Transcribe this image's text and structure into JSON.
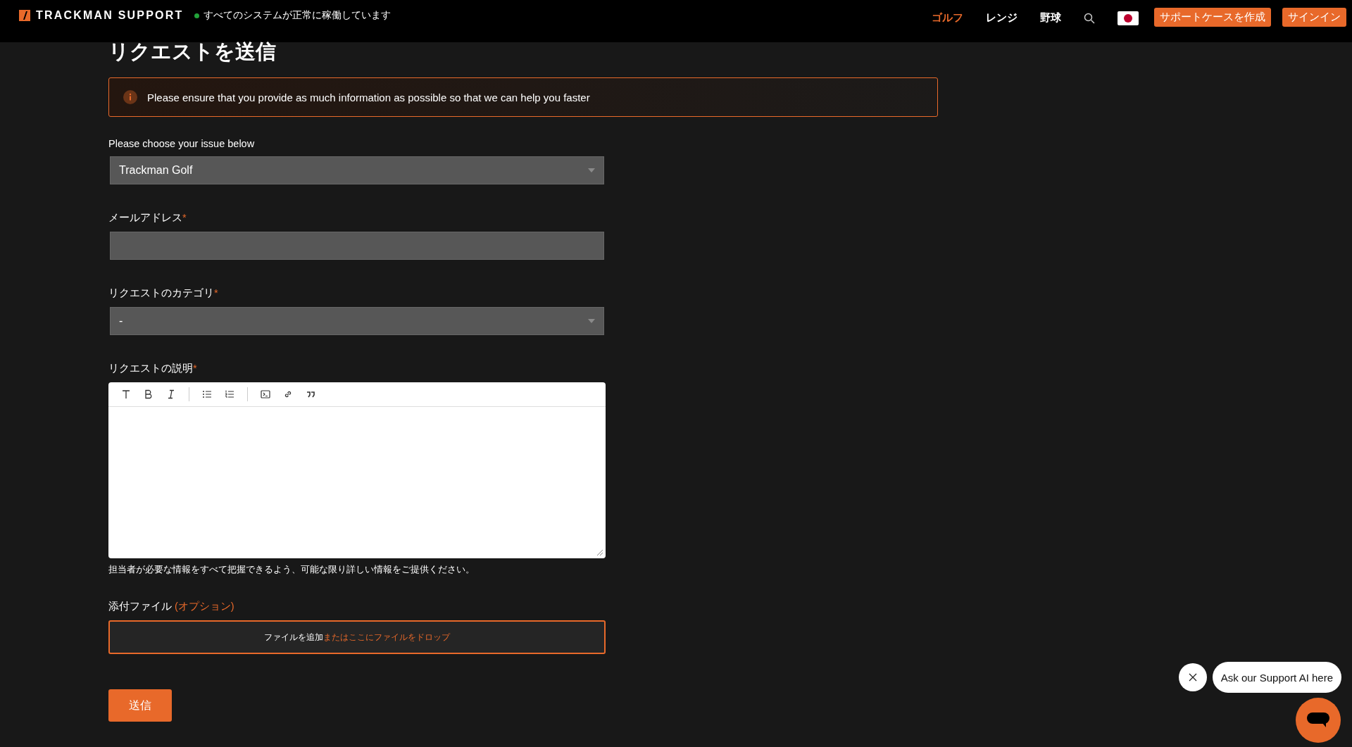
{
  "header": {
    "logo": "TRACKMAN SUPPORT",
    "status": {
      "text": "すべてのシステムが正常に稼働しています",
      "color": "#22a33a"
    },
    "nav": [
      {
        "label": "ゴルフ",
        "selected": true
      },
      {
        "label": "レンジ",
        "selected": false
      },
      {
        "label": "野球",
        "selected": false
      }
    ],
    "buttons": [
      "サポートケースを作成",
      "サインイン"
    ]
  },
  "title": "リクエストを送信",
  "notice": "Please ensure that you provide as much information as possible so that we can help you faster",
  "fields": [
    {
      "kind": "select",
      "label": "Please choose your issue below",
      "value": "Trackman Golf"
    },
    {
      "kind": "text",
      "label": "メールアドレス",
      "required_mark": "*"
    },
    {
      "kind": "select",
      "label": "リクエストのカテゴリ",
      "required_mark": "*",
      "value": "-"
    },
    {
      "kind": "editor",
      "label": "リクエストの説明",
      "required_mark": "*",
      "hint": "担当者が必要な情報をすべて把握できるよう、可能な限り詳しい情報をご提供ください。"
    }
  ],
  "attachments": {
    "label": "添付ファイル",
    "optional": "(オプション)",
    "add": "ファイルを追加",
    "drop": "またはここにファイルをドロップ"
  },
  "submit": "送信",
  "chat": {
    "prompt": "Ask our Support AI here"
  }
}
